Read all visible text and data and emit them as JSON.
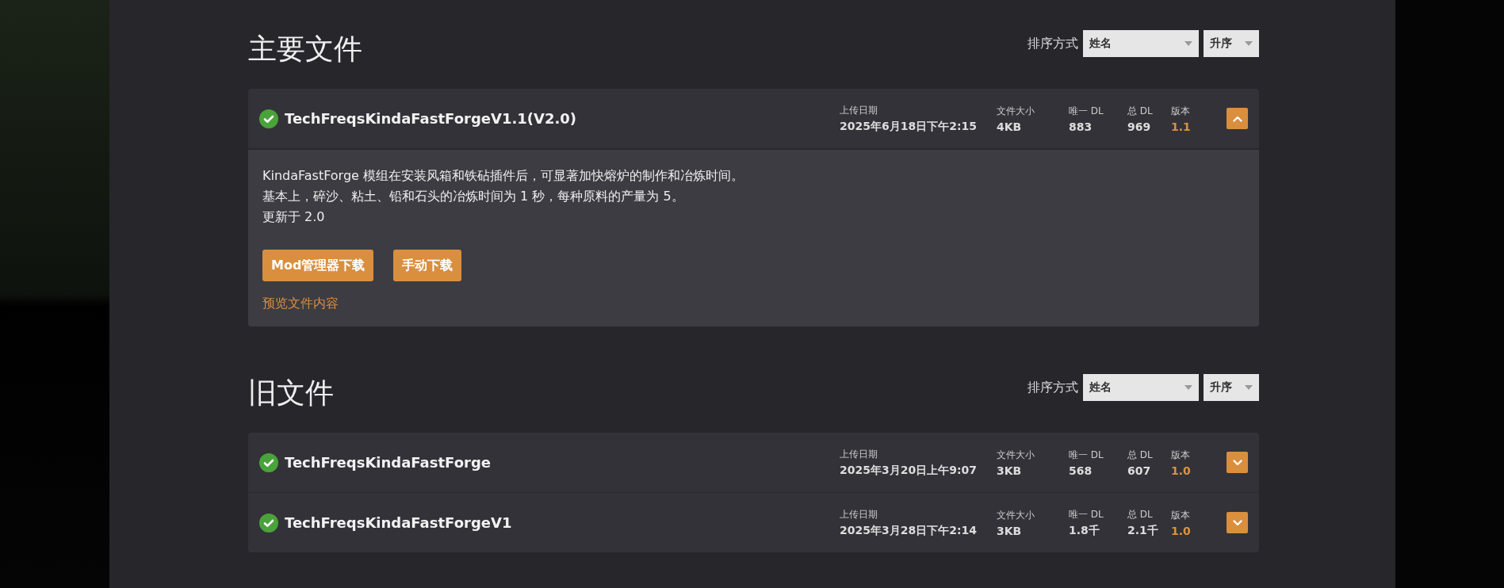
{
  "sections": [
    {
      "title": "主要文件",
      "sort": {
        "label": "排序方式",
        "field": "姓名",
        "order": "升序"
      },
      "files": [
        {
          "name": "TechFreqsKindaFastForgeV1.1(V2.0)",
          "verified": true,
          "expanded": true,
          "meta": [
            {
              "label": "上传日期",
              "value": "2025年6月18日下午2:15"
            },
            {
              "label": "文件大小",
              "value": "4KB"
            },
            {
              "label": "唯一 DL",
              "value": "883"
            },
            {
              "label": "总 DL",
              "value": "969"
            },
            {
              "label": "版本",
              "value": "1.1"
            }
          ],
          "description": [
            "KindaFastForge 模组在安装风箱和铁砧插件后，可显著加快熔炉的制作和冶炼时间。",
            "基本上，碎沙、粘土、铅和石头的冶炼时间为 1 秒，每种原料的产量为 5。",
            "更新于 2.0"
          ],
          "buttons": [
            "Mod管理器下载",
            "手动下载"
          ],
          "preview_link": "预览文件内容"
        }
      ]
    },
    {
      "title": "旧文件",
      "sort": {
        "label": "排序方式",
        "field": "姓名",
        "order": "升序"
      },
      "files": [
        {
          "name": "TechFreqsKindaFastForge",
          "verified": true,
          "expanded": false,
          "meta": [
            {
              "label": "上传日期",
              "value": "2025年3月20日上午9:07"
            },
            {
              "label": "文件大小",
              "value": "3KB"
            },
            {
              "label": "唯一 DL",
              "value": "568"
            },
            {
              "label": "总 DL",
              "value": "607"
            },
            {
              "label": "版本",
              "value": "1.0"
            }
          ]
        },
        {
          "name": "TechFreqsKindaFastForgeV1",
          "verified": true,
          "expanded": false,
          "meta": [
            {
              "label": "上传日期",
              "value": "2025年3月28日下午2:14"
            },
            {
              "label": "文件大小",
              "value": "3KB"
            },
            {
              "label": "唯一 DL",
              "value": "1.8千"
            },
            {
              "label": "总 DL",
              "value": "2.1千"
            },
            {
              "label": "版本",
              "value": "1.0"
            }
          ]
        }
      ]
    }
  ]
}
